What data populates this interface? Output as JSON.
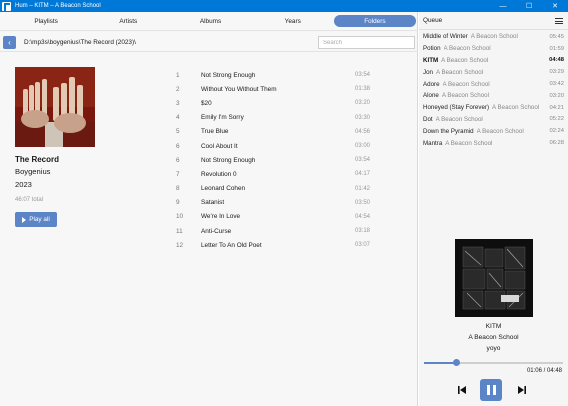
{
  "window": {
    "title": "Hum – KITM – A Beacon School",
    "minimize": "—",
    "maximize": "☐",
    "close": "✕"
  },
  "tabs": [
    {
      "label": "Playlists",
      "active": false
    },
    {
      "label": "Artists",
      "active": false
    },
    {
      "label": "Albums",
      "active": false
    },
    {
      "label": "Years",
      "active": false
    },
    {
      "label": "Folders",
      "active": true
    }
  ],
  "pathbar": {
    "back_icon": "chevron-left-icon",
    "path": "D:\\mp3s\\boygenius\\The Record (2023)\\",
    "search_placeholder": "Search"
  },
  "album": {
    "title": "The Record",
    "artist": "Boygenius",
    "year": "2023",
    "total": "46:07 total",
    "play_all": "Play all"
  },
  "tracks": [
    {
      "num": "1",
      "title": "Not Strong Enough",
      "duration": "03:54"
    },
    {
      "num": "2",
      "title": "Without You Without Them",
      "duration": "01:38"
    },
    {
      "num": "3",
      "title": "$20",
      "duration": "03:20"
    },
    {
      "num": "4",
      "title": "Emily I'm Sorry",
      "duration": "03:30"
    },
    {
      "num": "5",
      "title": "True Blue",
      "duration": "04:56"
    },
    {
      "num": "6",
      "title": "Cool About It",
      "duration": "03:00"
    },
    {
      "num": "6",
      "title": "Not Strong Enough",
      "duration": "03:54"
    },
    {
      "num": "7",
      "title": "Revolution 0",
      "duration": "04:17"
    },
    {
      "num": "8",
      "title": "Leonard Cohen",
      "duration": "01:42"
    },
    {
      "num": "9",
      "title": "Satanist",
      "duration": "03:50"
    },
    {
      "num": "10",
      "title": "We're In Love",
      "duration": "04:54"
    },
    {
      "num": "11",
      "title": "Anti-Curse",
      "duration": "03:18"
    },
    {
      "num": "12",
      "title": "Letter To An Old Poet",
      "duration": "03:07"
    }
  ],
  "queue": {
    "header": "Queue",
    "items": [
      {
        "title": "Middle of Winter",
        "artist": "A Beacon School",
        "duration": "05:45",
        "current": false
      },
      {
        "title": "Potion",
        "artist": "A Beacon School",
        "duration": "01:59",
        "current": false
      },
      {
        "title": "KITM",
        "artist": "A Beacon School",
        "duration": "04:48",
        "current": true
      },
      {
        "title": "Jon",
        "artist": "A Beacon School",
        "duration": "03:29",
        "current": false
      },
      {
        "title": "Adore",
        "artist": "A Beacon School",
        "duration": "03:42",
        "current": false
      },
      {
        "title": "Alone",
        "artist": "A Beacon School",
        "duration": "03:20",
        "current": false
      },
      {
        "title": "Honeyed (Stay Forever)",
        "artist": "A Beacon School",
        "duration": "04:21",
        "current": false
      },
      {
        "title": "Dot",
        "artist": "A Beacon School",
        "duration": "05:22",
        "current": false
      },
      {
        "title": "Down the Pyramid",
        "artist": "A Beacon School",
        "duration": "02:24",
        "current": false
      },
      {
        "title": "Mantra",
        "artist": "A Beacon School",
        "duration": "06:28",
        "current": false
      }
    ]
  },
  "now_playing": {
    "title": "KITM",
    "artist": "A Beacon School",
    "album": "yoyo",
    "time": "01:06 / 04:48",
    "progress_fraction": 0.23
  },
  "colors": {
    "accent": "#5b85c7",
    "titlebar": "#0078d7"
  }
}
